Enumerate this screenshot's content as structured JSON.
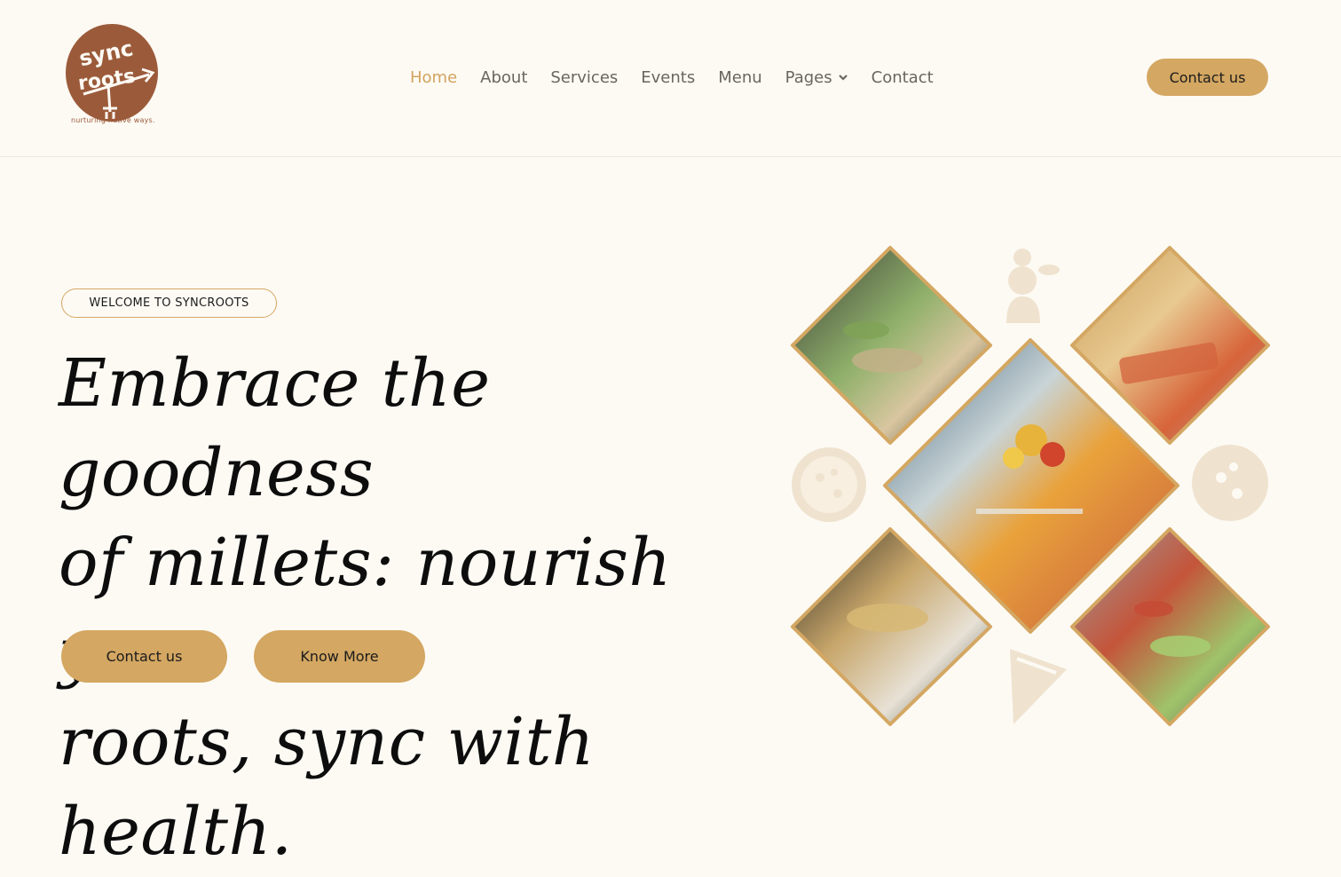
{
  "brand": {
    "logo_text_top": "sync",
    "logo_text_bottom": "roots",
    "tagline": "nurturing native ways.",
    "color": "#9b5b3a"
  },
  "nav": {
    "items": [
      {
        "label": "Home",
        "active": true
      },
      {
        "label": "About"
      },
      {
        "label": "Services"
      },
      {
        "label": "Events"
      },
      {
        "label": "Menu"
      },
      {
        "label": "Pages",
        "has_dropdown": true
      },
      {
        "label": "Contact"
      }
    ],
    "active_color": "#d2a35e"
  },
  "header_cta": {
    "label": "Contact us"
  },
  "hero": {
    "badge": "WELCOME TO SYNCROOTS",
    "headline_lines": [
      "Embrace the goodness",
      "of millets: nourish your",
      "roots, sync with health."
    ],
    "buttons": [
      {
        "label": "Contact us"
      },
      {
        "label": "Know More"
      }
    ]
  },
  "collage": {
    "tiles": [
      {
        "name": "salad-buffet-photo",
        "icon": "photo"
      },
      {
        "name": "bruschetta-platter-photo",
        "icon": "photo"
      },
      {
        "name": "table-setting-flowers-photo",
        "icon": "photo"
      },
      {
        "name": "chafing-dish-buffet-photo",
        "icon": "photo"
      },
      {
        "name": "appetizer-table-photo",
        "icon": "photo"
      }
    ],
    "decor_icons": [
      "chef-icon",
      "pizza-icon",
      "pizza-icon",
      "pizza-slice-icon"
    ],
    "accent": "#d4a762"
  },
  "colors": {
    "background": "#fdfaf4",
    "accent": "#d4a762",
    "text": "#0d0d0d",
    "nav_text": "#6a655e"
  }
}
